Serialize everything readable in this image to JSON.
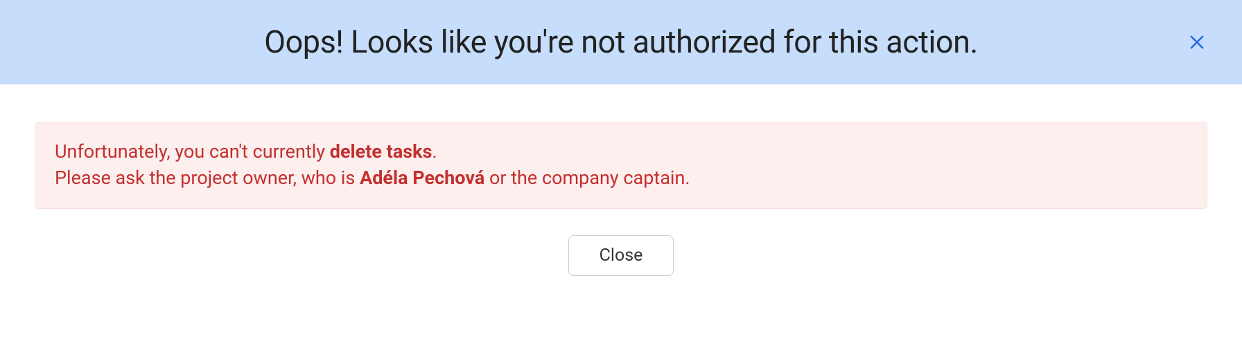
{
  "header": {
    "title": "Oops! Looks like you're not authorized for this action."
  },
  "alert": {
    "line1_prefix": "Unfortunately, you can't currently ",
    "line1_bold": "delete tasks",
    "line1_suffix": ".",
    "line2_prefix": "Please ask the project owner, who is ",
    "line2_bold": "Adéla Pechová",
    "line2_suffix": " or the company captain."
  },
  "buttons": {
    "close": "Close"
  }
}
